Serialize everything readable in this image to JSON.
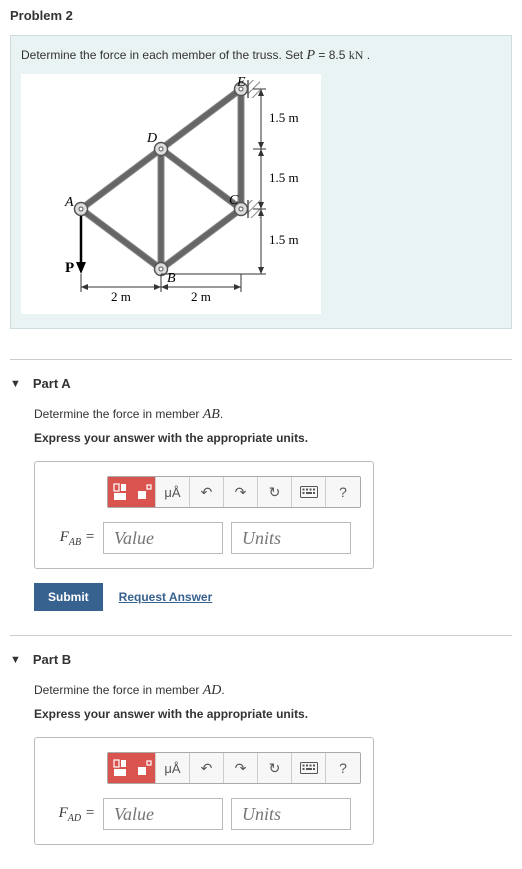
{
  "problem": {
    "title": "Problem 2",
    "stem_prefix": "Determine the force in each member of the truss. Set ",
    "stem_var": "P",
    "stem_eq": " = 8.5 ",
    "stem_unit": "kN",
    "stem_suffix": " ."
  },
  "figure": {
    "labels": {
      "E": "E",
      "D": "D",
      "C": "C",
      "A": "A",
      "B": "B",
      "P": "P",
      "d1": "1.5 m",
      "d2": "1.5 m",
      "d3": "1.5 m",
      "h1": "2 m",
      "h2": "2 m"
    }
  },
  "partA": {
    "label": "Part A",
    "prompt_prefix": "Determine the force in member ",
    "prompt_var": "AB",
    "prompt_suffix": ".",
    "instruction": "Express your answer with the appropriate units.",
    "varlabel": "F",
    "varsub": "AB",
    "value_placeholder": "Value",
    "units_placeholder": "Units",
    "submit": "Submit",
    "request": "Request Answer"
  },
  "partB": {
    "label": "Part B",
    "prompt_prefix": "Determine the force in member ",
    "prompt_var": "AD",
    "prompt_suffix": ".",
    "instruction": "Express your answer with the appropriate units.",
    "varlabel": "F",
    "varsub": "AD",
    "value_placeholder": "Value",
    "units_placeholder": "Units"
  },
  "toolbar": {
    "mu": "μÅ",
    "undo": "↶",
    "redo": "↷",
    "reset": "↻",
    "help": "?"
  }
}
